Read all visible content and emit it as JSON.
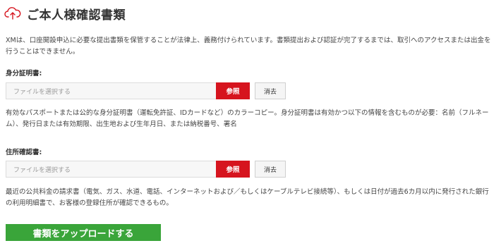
{
  "header": {
    "icon": "cloud-upload-icon",
    "title": "ご本人様確認書類"
  },
  "intro": {
    "text": "XMは、口座開設申込に必要な提出書類を保管することが法律上、義務付けられています。書類提出および認証が完了するまでは、取引へのアクセスまたは出金を行うことはできません。"
  },
  "id_document": {
    "label": "身分証明書:",
    "placeholder": "ファイルを選択する",
    "browse_label": "参照",
    "clear_label": "消去",
    "description": "有効なパスポートまたは公的な身分証明書（運転免許証、IDカードなど）のカラーコピー。身分証明書は有効かつ以下の情報を含むものが必要：名前（フルネーム）、発行日または有効期限、出生地および生年月日、または納税番号、署名"
  },
  "address_document": {
    "label": "住所確認書:",
    "placeholder": "ファイルを選択する",
    "browse_label": "参照",
    "clear_label": "消去",
    "description": "最近の公共料金の請求書（電気、ガス、水道、電話、インターネットおよび／もしくはケーブルテレビ接続等）、もしくは日付が過去6カ月以内に発行された銀行の利用明細書で、お客様の登録住所が確認できるもの。"
  },
  "upload": {
    "label": "書類をアップロードする"
  },
  "colors": {
    "browse": "#d6141e",
    "upload": "#3aa53a",
    "icon": "#d6141e"
  }
}
